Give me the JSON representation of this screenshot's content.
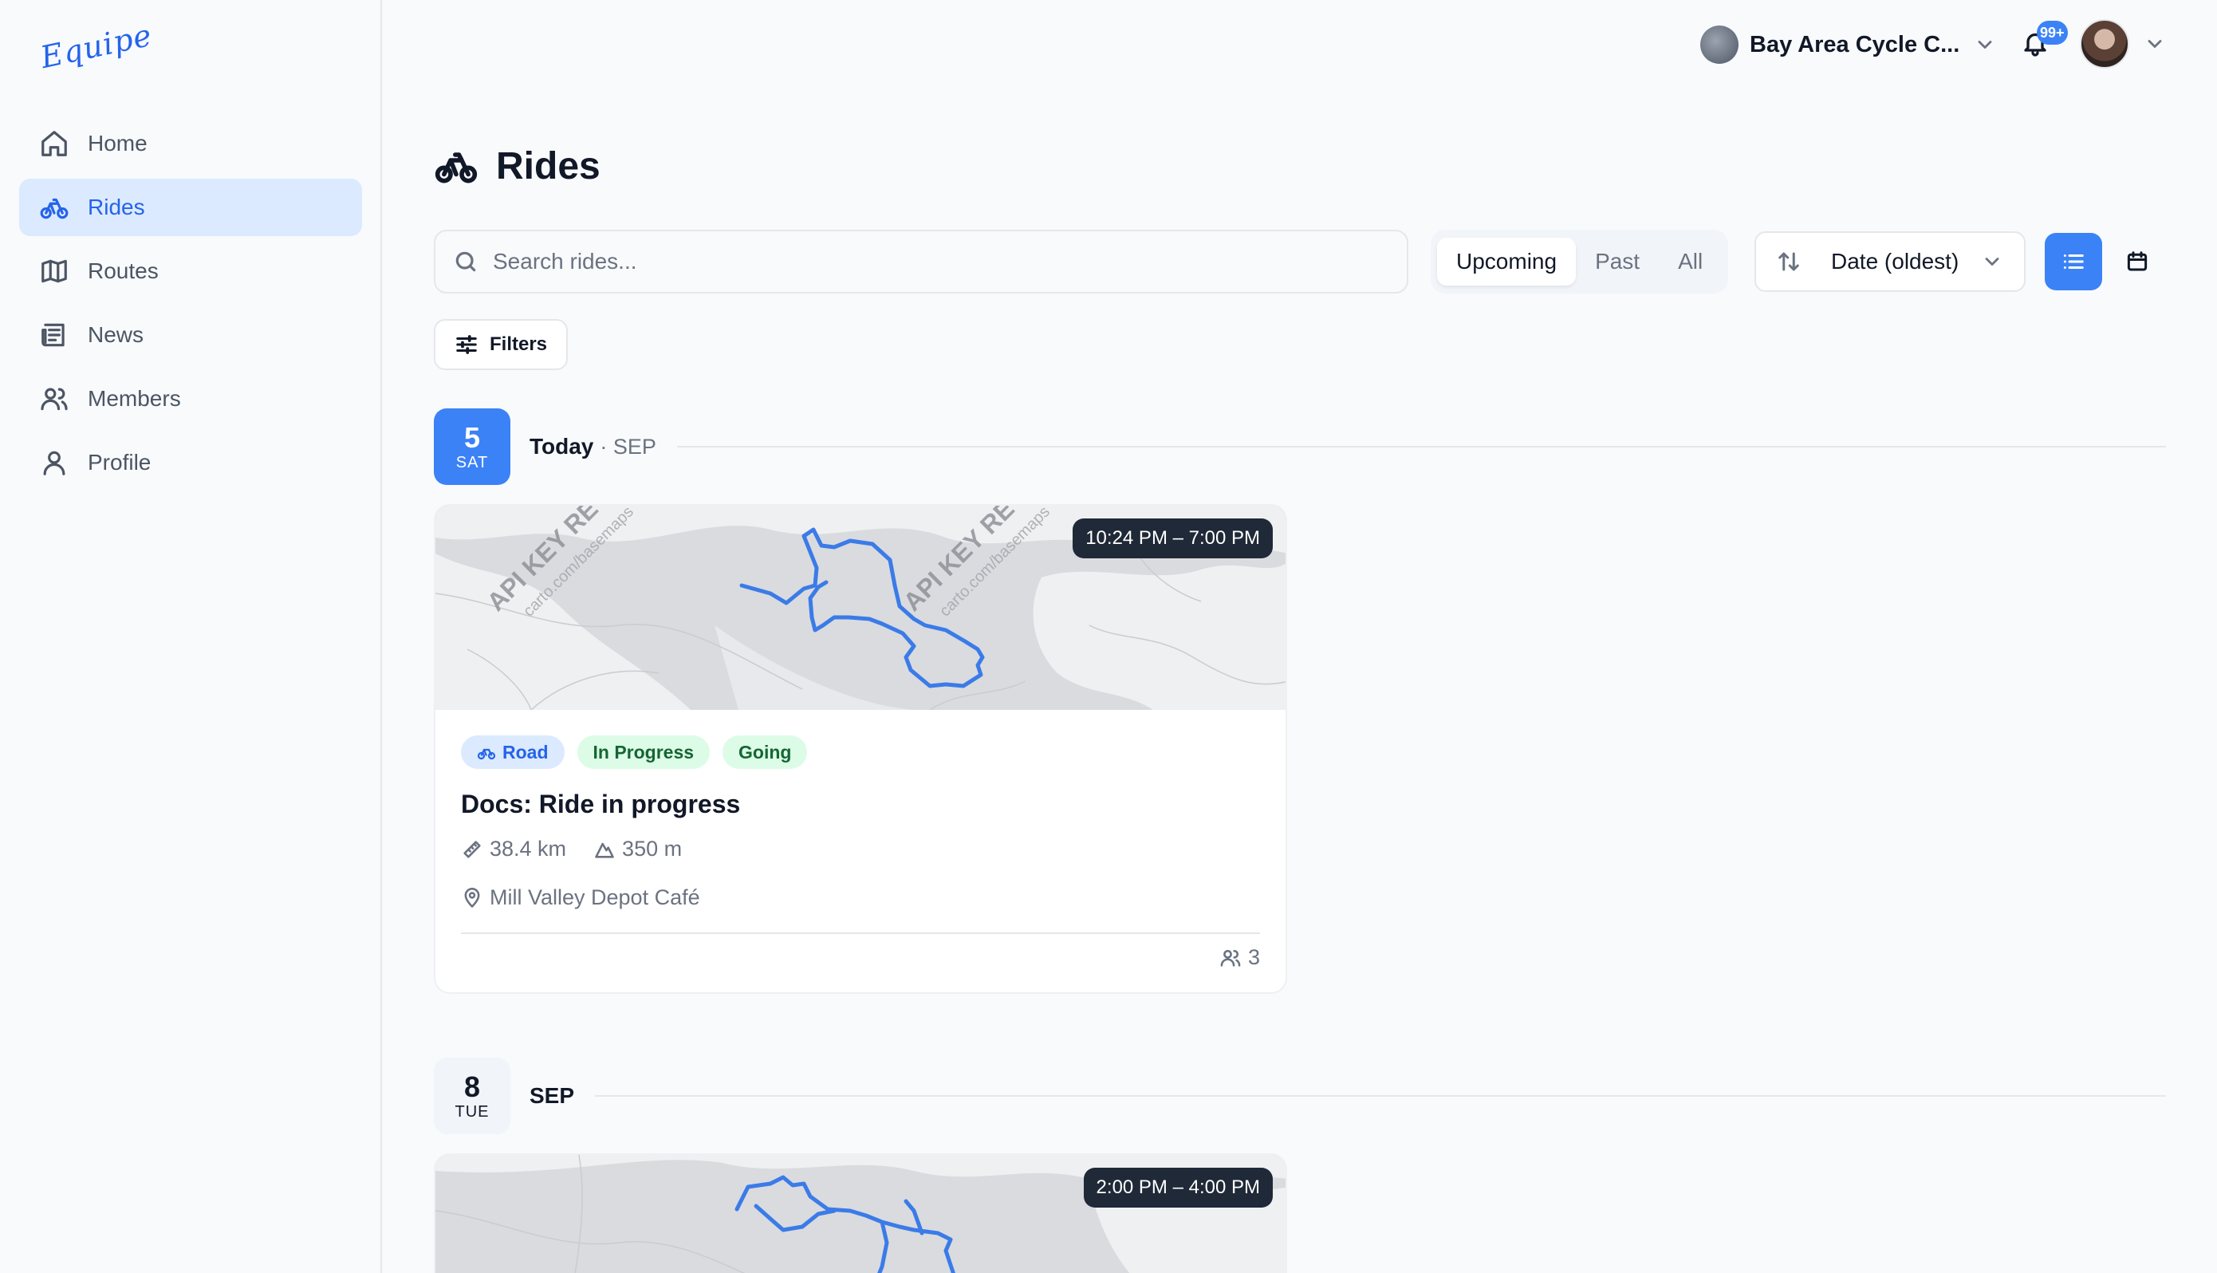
{
  "app": {
    "logo_text": "Equipe"
  },
  "sidebar": {
    "items": [
      {
        "label": "Home",
        "icon": "home-icon"
      },
      {
        "label": "Rides",
        "icon": "bike-icon",
        "active": true
      },
      {
        "label": "Routes",
        "icon": "map-icon"
      },
      {
        "label": "News",
        "icon": "newspaper-icon"
      },
      {
        "label": "Members",
        "icon": "users-icon"
      },
      {
        "label": "Profile",
        "icon": "user-icon"
      }
    ]
  },
  "topbar": {
    "club_name": "Bay Area Cycle C...",
    "notifications_badge": "99+"
  },
  "page": {
    "title": "Rides"
  },
  "controls": {
    "search_placeholder": "Search rides...",
    "segments": [
      "Upcoming",
      "Past",
      "All"
    ],
    "active_segment": "Upcoming",
    "sort_label": "Date (oldest)",
    "filters_label": "Filters"
  },
  "groups": [
    {
      "day": "5",
      "dow": "SAT",
      "label": "Today",
      "month": "· SEP",
      "rides": [
        {
          "time": "10:24 PM – 7:00 PM",
          "tags": [
            "Road",
            "In Progress",
            "Going"
          ],
          "title": "Docs: Ride in progress",
          "distance": "38.4 km",
          "elevation": "350 m",
          "location": "Mill Valley Depot Café",
          "participants": "3",
          "map_watermark": "API KEY RE",
          "map_credit": "carto.com/basemaps"
        }
      ]
    },
    {
      "day": "8",
      "dow": "TUE",
      "label": "SEP",
      "rides": [
        {
          "time": "2:00 PM – 4:00 PM"
        }
      ]
    }
  ],
  "colors": {
    "accent": "#3b82f6",
    "route": "#3b7be8",
    "green_tag": "#dcfce7"
  }
}
